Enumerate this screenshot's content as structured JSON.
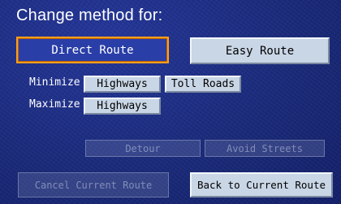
{
  "screen": {
    "title": "Change method for:"
  },
  "methods": {
    "direct_route": "Direct Route",
    "easy_route": "Easy Route",
    "selected": "direct_route"
  },
  "options": {
    "minimize_label": "Minimize",
    "maximize_label": "Maximize",
    "minimize_highways": "Highways",
    "minimize_toll_roads": "Toll Roads",
    "maximize_highways": "Highways"
  },
  "route_actions": {
    "detour": "Detour",
    "avoid_streets": "Avoid Streets",
    "cancel_current_route": "Cancel Current Route",
    "back_to_current_route": "Back to Current Route"
  },
  "colors": {
    "background": "#1a2a78",
    "selected_border": "#ff9f1a",
    "button_face": "#c9d6e6"
  }
}
